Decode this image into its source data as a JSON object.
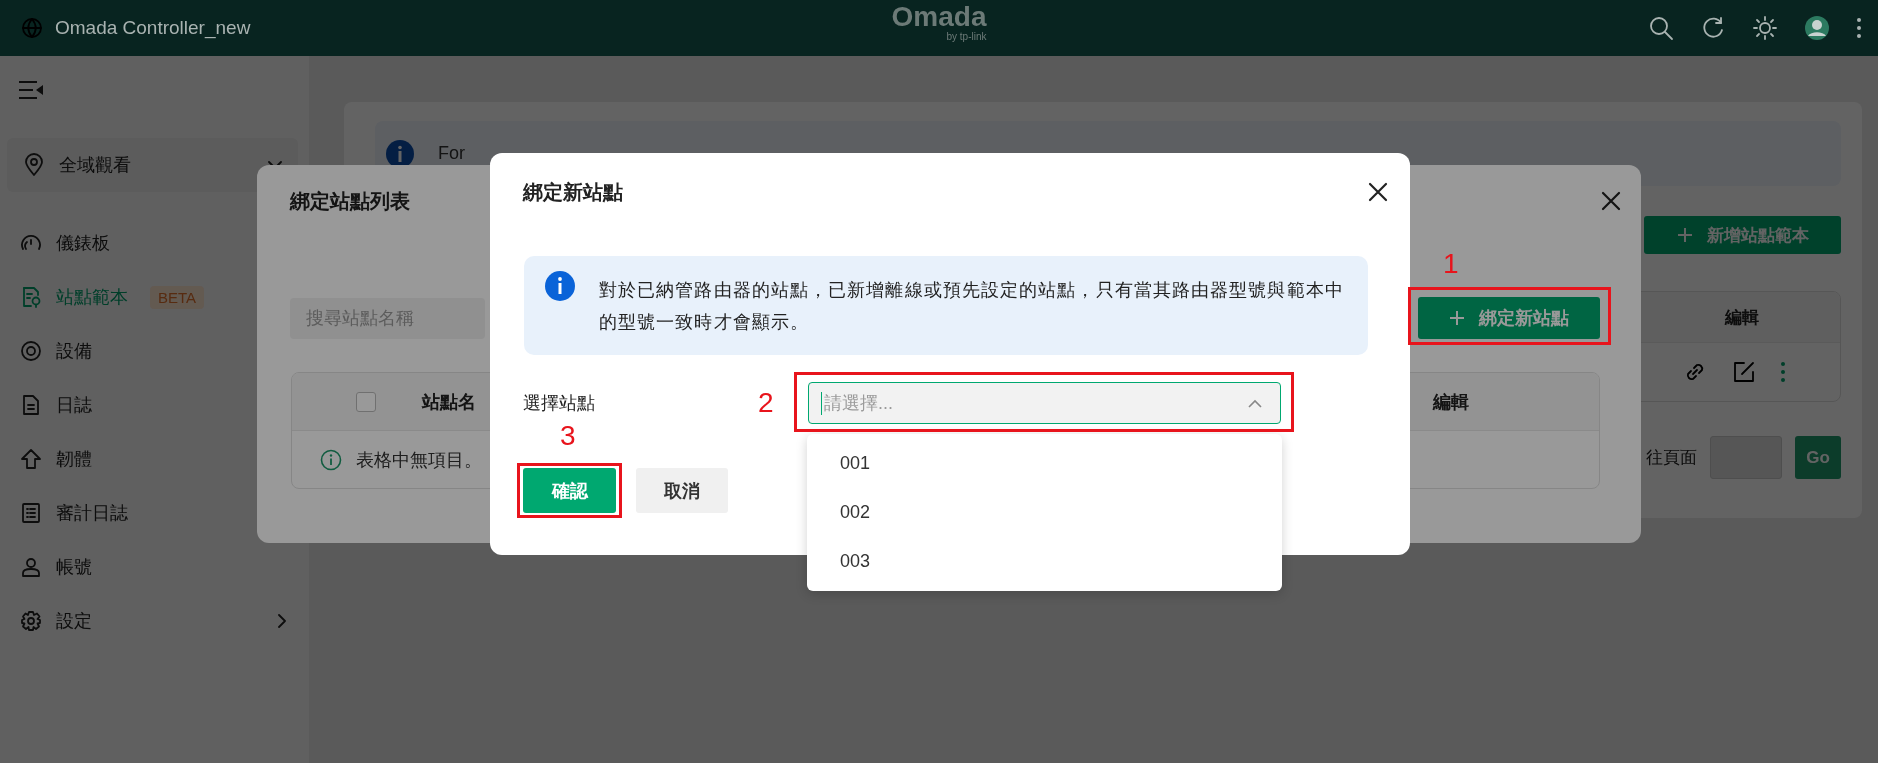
{
  "header": {
    "title": "Omada Controller_new",
    "logo": "Omada",
    "logo_sub": "by tp-link"
  },
  "sidebar": {
    "region": "全域觀看",
    "items": [
      {
        "label": "儀錶板",
        "selected": false
      },
      {
        "label": "站點範本",
        "selected": true,
        "badge": "BETA"
      },
      {
        "label": "設備",
        "selected": false
      },
      {
        "label": "日誌",
        "selected": false
      },
      {
        "label": "韌體",
        "selected": false
      },
      {
        "label": "審計日誌",
        "selected": false
      },
      {
        "label": "帳號",
        "selected": false
      },
      {
        "label": "設定",
        "selected": false,
        "expandable": true
      }
    ]
  },
  "page": {
    "info_text": "For",
    "add_button": "新增站點範本",
    "table": {
      "columns": [
        "編輯"
      ]
    },
    "pagination": {
      "goto_label": "往頁面",
      "go_button": "Go"
    }
  },
  "list_dialog": {
    "title": "綁定站點列表",
    "search_placeholder": "搜尋站點名稱",
    "bind_button": "綁定新站點",
    "table": {
      "select_all_checked": false,
      "columns": [
        "站點名",
        "編輯"
      ],
      "empty_text": "表格中無項目。"
    }
  },
  "bind_dialog": {
    "title": "綁定新站點",
    "notice": "對於已納管路由器的站點，已新增離線或預先設定的站點，只有當其路由器型號與範本中的型號一致時才會顯示。",
    "field_label": "選擇站點",
    "select": {
      "placeholder": "請選擇...",
      "expanded": true,
      "options": [
        "001",
        "002",
        "003"
      ]
    },
    "buttons": [
      {
        "label": "確認",
        "kind": "primary"
      },
      {
        "label": "取消",
        "kind": "secondary"
      }
    ]
  },
  "annotations": [
    {
      "number": "1"
    },
    {
      "number": "2"
    },
    {
      "number": "3"
    }
  ]
}
